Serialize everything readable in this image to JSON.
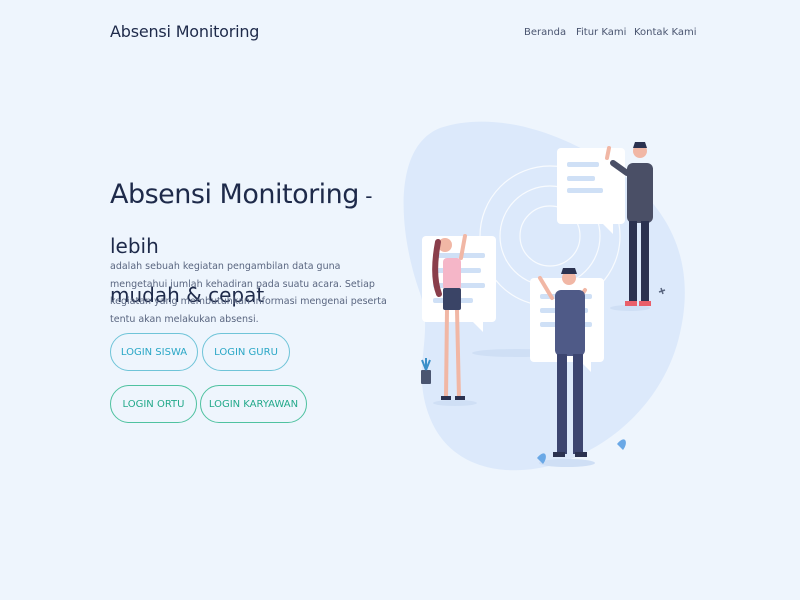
{
  "brand": "Absensi Monitoring",
  "nav": {
    "beranda": "Beranda",
    "fitur": "Fitur Kami",
    "kontak": "Kontak Kami"
  },
  "hero": {
    "title_main": "Absensi Monitoring",
    "title_rest": " - lebih",
    "title_line2": "mudah & cepat",
    "description": "adalah sebuah kegiatan pengambilan data guna mengetahui jumlah kehadiran pada suatu acara. Setiap kegiatan yang membutuhkan informasi mengenai peserta tentu akan melakukan absensi."
  },
  "buttons": {
    "siswa": "LOGIN SISWA",
    "guru": "LOGIN GURU",
    "ortu": "LOGIN ORTU",
    "karyawan": "LOGIN KARYAWAN"
  },
  "colors": {
    "background": "#eef5fd",
    "accent_blue": "#2aa7c6",
    "accent_green": "#23a98a",
    "text_dark": "#1e2a4a"
  },
  "icons": [
    "people-collaboration-illustration"
  ]
}
